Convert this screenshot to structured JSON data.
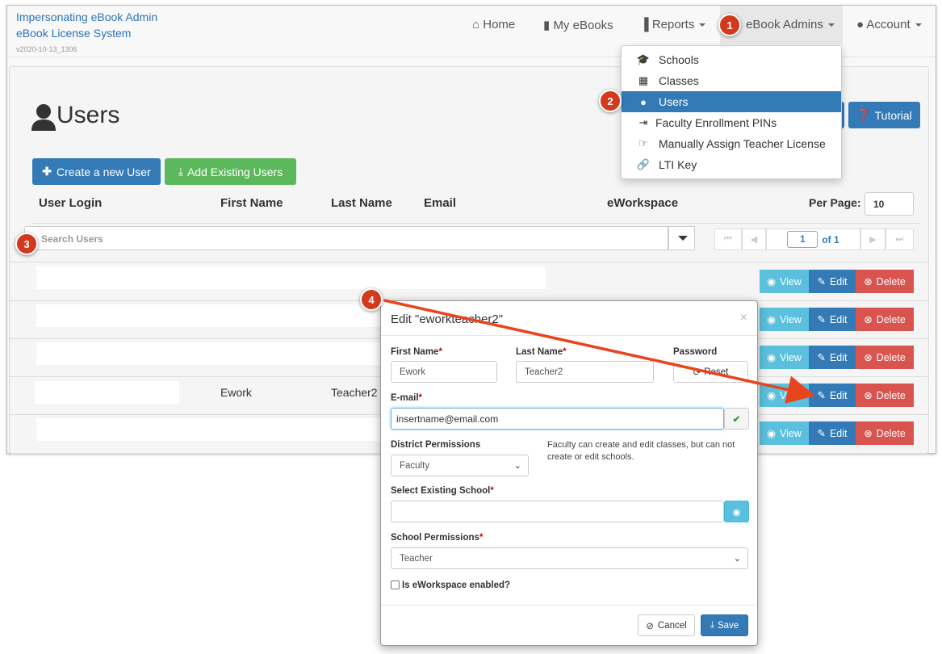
{
  "brand": {
    "line1": "Impersonating eBook Admin",
    "line2": "eBook License System",
    "version": "v2020-10-13_1306"
  },
  "nav": {
    "home": "Home",
    "my_ebooks": "My eBooks",
    "reports": "Reports",
    "ebook_admins": "eBook Admins",
    "account": "Account"
  },
  "dropdown": {
    "items": [
      {
        "icon": "graduation-cap-icon",
        "label": "Schools"
      },
      {
        "icon": "calendar-icon",
        "label": "Classes"
      },
      {
        "icon": "user-icon",
        "label": "Users"
      },
      {
        "icon": "sign-in-icon",
        "label": "Faculty Enrollment PINs"
      },
      {
        "icon": "hand-point-icon",
        "label": "Manually Assign Teacher License"
      },
      {
        "icon": "link-icon",
        "label": "LTI Key"
      }
    ]
  },
  "page": {
    "title": "Users",
    "create_btn": "Create a new User",
    "add_btn": "Add Existing Users",
    "tutorial_btn": "Tutorial"
  },
  "table": {
    "headers": [
      "User Login",
      "First Name",
      "Last Name",
      "Email",
      "eWorkspace"
    ],
    "per_page_label": "Per Page:",
    "per_page_value": "10",
    "search_placeholder": "Search Users",
    "page_current": "1",
    "page_of": "of 1",
    "row4": {
      "first": "Ework",
      "last": "Teacher2"
    },
    "view": "View",
    "edit": "Edit",
    "delete": "Delete"
  },
  "modal": {
    "title": "Edit \"eworkteacher2\"",
    "first_name_label": "First Name",
    "first_name": "Ework",
    "last_name_label": "Last Name",
    "last_name": "Teacher2",
    "password_label": "Password",
    "reset": "Reset",
    "email_label": "E-mail",
    "email": "insertname@email.com",
    "district_label": "District Permissions",
    "district_value": "Faculty",
    "district_help": "Faculty can create and edit classes, but can not create or edit schools.",
    "school_label": "Select Existing School",
    "school_perm_label": "School Permissions",
    "school_perm_value": "Teacher",
    "eworkspace_label": "Is eWorkspace enabled?",
    "cancel": "Cancel",
    "save": "Save"
  },
  "annotations": [
    "1",
    "2",
    "3",
    "4"
  ],
  "colors": {
    "primary": "#337ab7",
    "success": "#5cb85c",
    "info": "#5bc0de",
    "danger": "#d9534f",
    "annotation": "#d2391d"
  }
}
